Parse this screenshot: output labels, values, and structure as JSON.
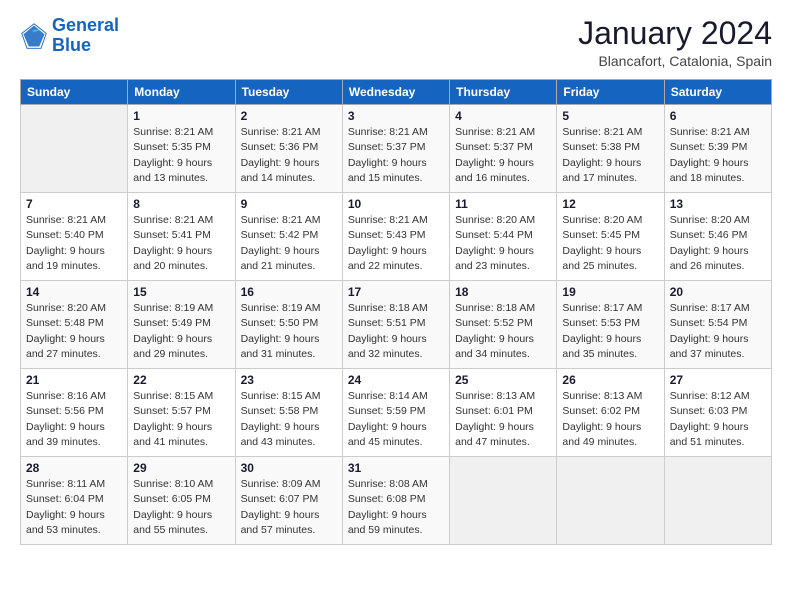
{
  "logo": {
    "line1": "General",
    "line2": "Blue"
  },
  "header": {
    "month": "January 2024",
    "location": "Blancafort, Catalonia, Spain"
  },
  "weekdays": [
    "Sunday",
    "Monday",
    "Tuesday",
    "Wednesday",
    "Thursday",
    "Friday",
    "Saturday"
  ],
  "weeks": [
    [
      {
        "day": "",
        "info": ""
      },
      {
        "day": "1",
        "info": "Sunrise: 8:21 AM\nSunset: 5:35 PM\nDaylight: 9 hours\nand 13 minutes."
      },
      {
        "day": "2",
        "info": "Sunrise: 8:21 AM\nSunset: 5:36 PM\nDaylight: 9 hours\nand 14 minutes."
      },
      {
        "day": "3",
        "info": "Sunrise: 8:21 AM\nSunset: 5:37 PM\nDaylight: 9 hours\nand 15 minutes."
      },
      {
        "day": "4",
        "info": "Sunrise: 8:21 AM\nSunset: 5:37 PM\nDaylight: 9 hours\nand 16 minutes."
      },
      {
        "day": "5",
        "info": "Sunrise: 8:21 AM\nSunset: 5:38 PM\nDaylight: 9 hours\nand 17 minutes."
      },
      {
        "day": "6",
        "info": "Sunrise: 8:21 AM\nSunset: 5:39 PM\nDaylight: 9 hours\nand 18 minutes."
      }
    ],
    [
      {
        "day": "7",
        "info": "Sunrise: 8:21 AM\nSunset: 5:40 PM\nDaylight: 9 hours\nand 19 minutes."
      },
      {
        "day": "8",
        "info": "Sunrise: 8:21 AM\nSunset: 5:41 PM\nDaylight: 9 hours\nand 20 minutes."
      },
      {
        "day": "9",
        "info": "Sunrise: 8:21 AM\nSunset: 5:42 PM\nDaylight: 9 hours\nand 21 minutes."
      },
      {
        "day": "10",
        "info": "Sunrise: 8:21 AM\nSunset: 5:43 PM\nDaylight: 9 hours\nand 22 minutes."
      },
      {
        "day": "11",
        "info": "Sunrise: 8:20 AM\nSunset: 5:44 PM\nDaylight: 9 hours\nand 23 minutes."
      },
      {
        "day": "12",
        "info": "Sunrise: 8:20 AM\nSunset: 5:45 PM\nDaylight: 9 hours\nand 25 minutes."
      },
      {
        "day": "13",
        "info": "Sunrise: 8:20 AM\nSunset: 5:46 PM\nDaylight: 9 hours\nand 26 minutes."
      }
    ],
    [
      {
        "day": "14",
        "info": "Sunrise: 8:20 AM\nSunset: 5:48 PM\nDaylight: 9 hours\nand 27 minutes."
      },
      {
        "day": "15",
        "info": "Sunrise: 8:19 AM\nSunset: 5:49 PM\nDaylight: 9 hours\nand 29 minutes."
      },
      {
        "day": "16",
        "info": "Sunrise: 8:19 AM\nSunset: 5:50 PM\nDaylight: 9 hours\nand 31 minutes."
      },
      {
        "day": "17",
        "info": "Sunrise: 8:18 AM\nSunset: 5:51 PM\nDaylight: 9 hours\nand 32 minutes."
      },
      {
        "day": "18",
        "info": "Sunrise: 8:18 AM\nSunset: 5:52 PM\nDaylight: 9 hours\nand 34 minutes."
      },
      {
        "day": "19",
        "info": "Sunrise: 8:17 AM\nSunset: 5:53 PM\nDaylight: 9 hours\nand 35 minutes."
      },
      {
        "day": "20",
        "info": "Sunrise: 8:17 AM\nSunset: 5:54 PM\nDaylight: 9 hours\nand 37 minutes."
      }
    ],
    [
      {
        "day": "21",
        "info": "Sunrise: 8:16 AM\nSunset: 5:56 PM\nDaylight: 9 hours\nand 39 minutes."
      },
      {
        "day": "22",
        "info": "Sunrise: 8:15 AM\nSunset: 5:57 PM\nDaylight: 9 hours\nand 41 minutes."
      },
      {
        "day": "23",
        "info": "Sunrise: 8:15 AM\nSunset: 5:58 PM\nDaylight: 9 hours\nand 43 minutes."
      },
      {
        "day": "24",
        "info": "Sunrise: 8:14 AM\nSunset: 5:59 PM\nDaylight: 9 hours\nand 45 minutes."
      },
      {
        "day": "25",
        "info": "Sunrise: 8:13 AM\nSunset: 6:01 PM\nDaylight: 9 hours\nand 47 minutes."
      },
      {
        "day": "26",
        "info": "Sunrise: 8:13 AM\nSunset: 6:02 PM\nDaylight: 9 hours\nand 49 minutes."
      },
      {
        "day": "27",
        "info": "Sunrise: 8:12 AM\nSunset: 6:03 PM\nDaylight: 9 hours\nand 51 minutes."
      }
    ],
    [
      {
        "day": "28",
        "info": "Sunrise: 8:11 AM\nSunset: 6:04 PM\nDaylight: 9 hours\nand 53 minutes."
      },
      {
        "day": "29",
        "info": "Sunrise: 8:10 AM\nSunset: 6:05 PM\nDaylight: 9 hours\nand 55 minutes."
      },
      {
        "day": "30",
        "info": "Sunrise: 8:09 AM\nSunset: 6:07 PM\nDaylight: 9 hours\nand 57 minutes."
      },
      {
        "day": "31",
        "info": "Sunrise: 8:08 AM\nSunset: 6:08 PM\nDaylight: 9 hours\nand 59 minutes."
      },
      {
        "day": "",
        "info": ""
      },
      {
        "day": "",
        "info": ""
      },
      {
        "day": "",
        "info": ""
      }
    ]
  ]
}
